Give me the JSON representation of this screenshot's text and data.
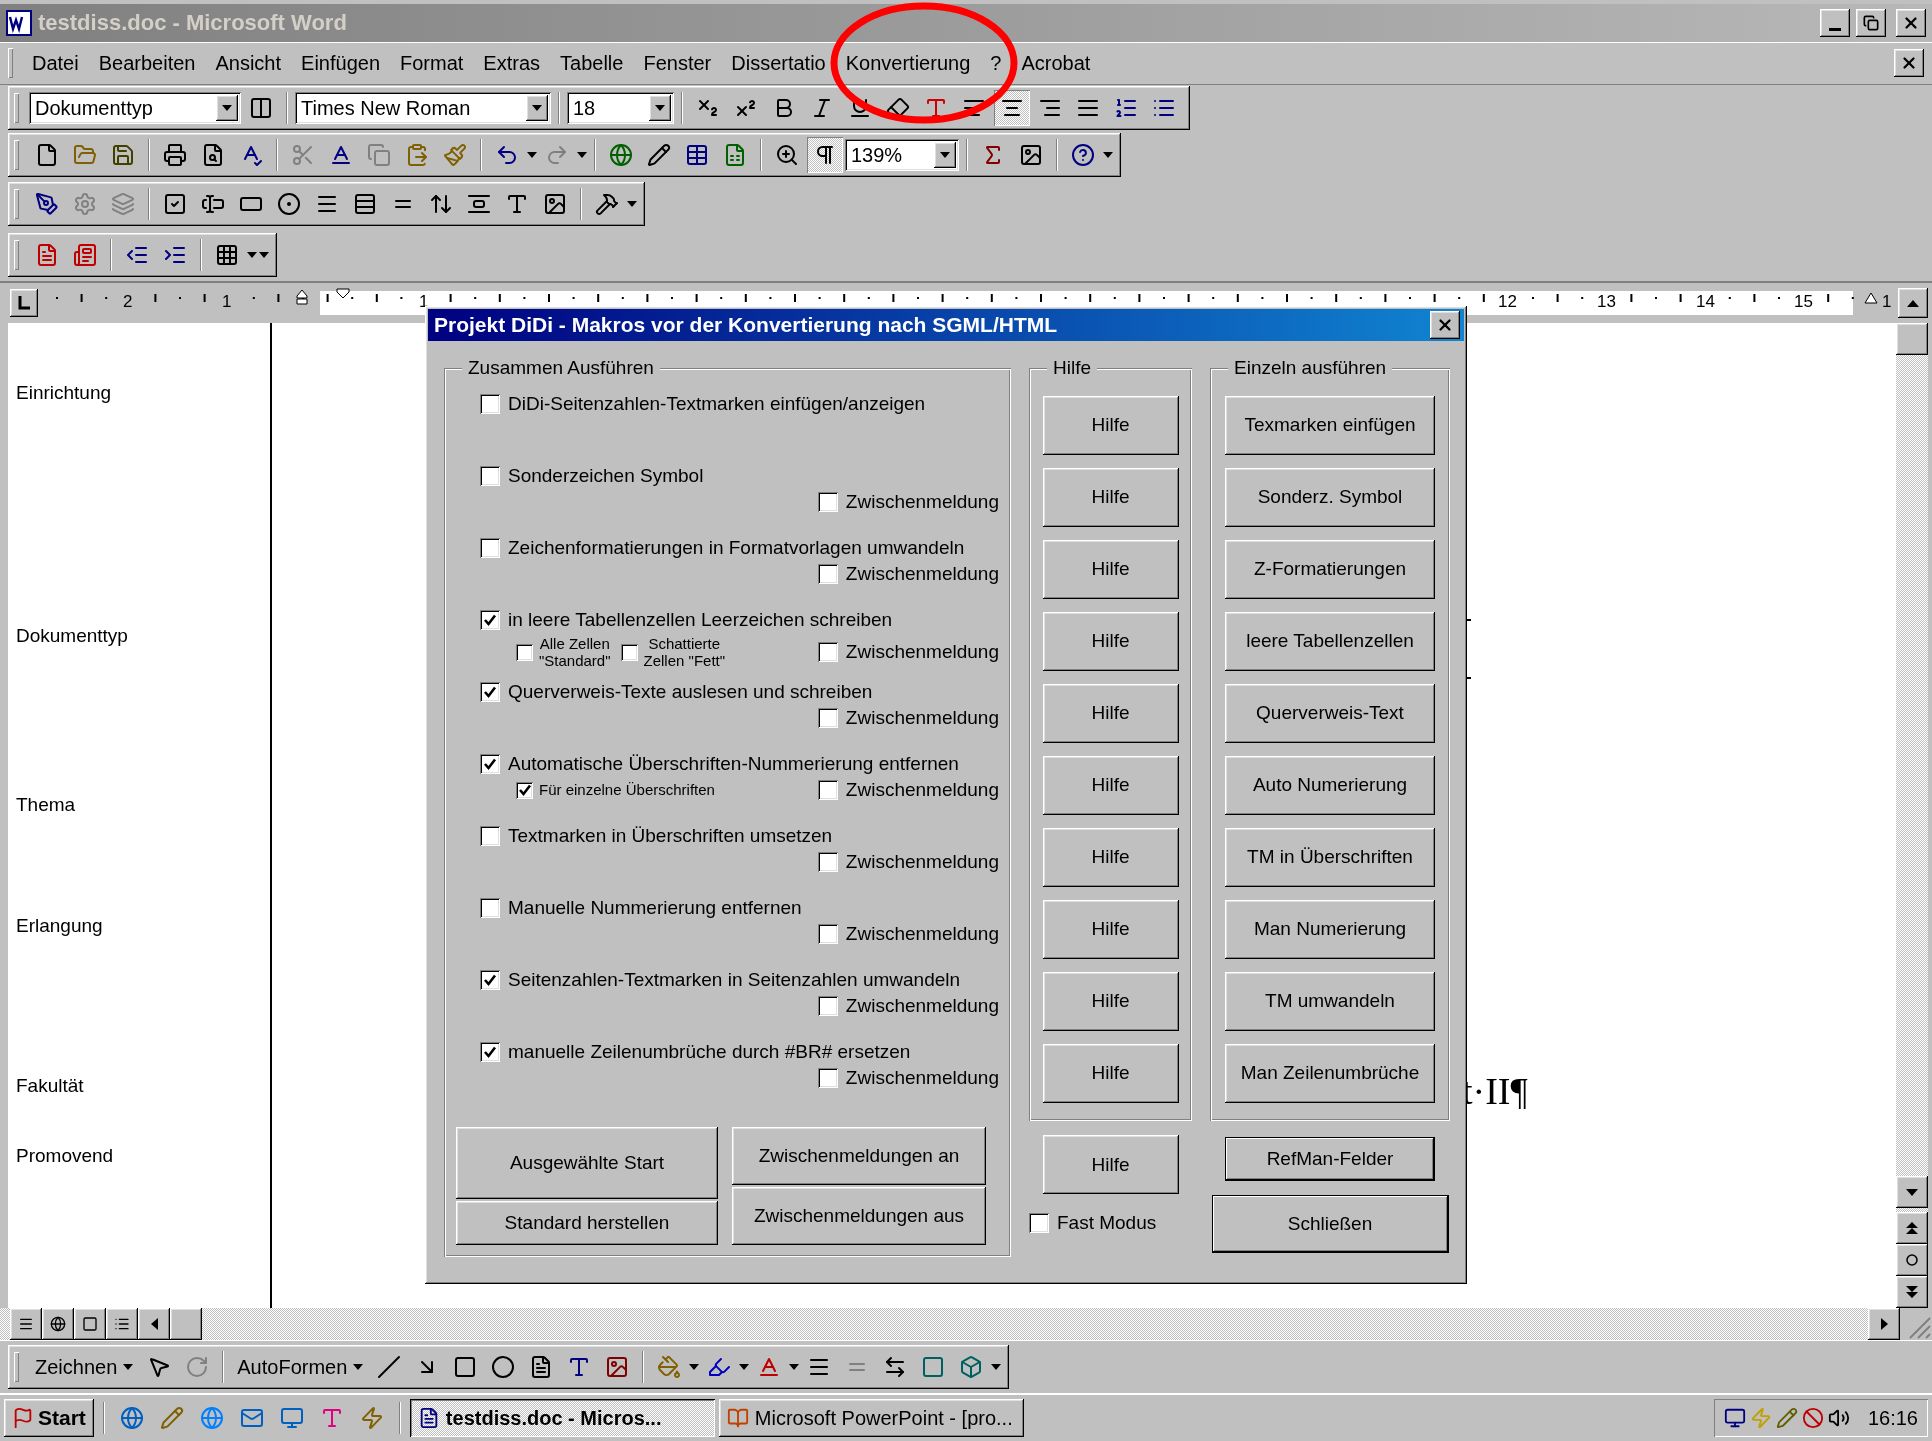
{
  "window": {
    "title": "testdiss.doc - Microsoft Word"
  },
  "menu": [
    "Datei",
    "Bearbeiten",
    "Ansicht",
    "Einfügen",
    "Format",
    "Extras",
    "Tabelle",
    "Fenster",
    "Dissertatio",
    "Konvertierung",
    "?",
    "Acrobat"
  ],
  "formatting_toolbar": {
    "style": "Dokumenttyp",
    "font": "Times New Roman",
    "size": "18",
    "align_center_on": true
  },
  "standard_toolbar": {
    "zoom": "139%",
    "formatting_marks_on": true
  },
  "ruler": {
    "numbers": [
      "2",
      "1",
      "1",
      "12",
      "13",
      "14",
      "15",
      "1"
    ]
  },
  "style_area": [
    "Einrichtung",
    "Dokumenttyp",
    "Thema",
    "Erlangung",
    "Fakultät",
    "Promovend"
  ],
  "document": {
    "fragment": "t·II¶"
  },
  "dialog": {
    "title": "Projekt DiDi - Makros vor der Konvertierung nach SGML/HTML",
    "run_group": {
      "legend": "Zusammen Ausführen",
      "options": [
        {
          "label": "DiDi-Seitenzahlen-Textmarken einfügen/anzeigen",
          "checked": false
        },
        {
          "label": "Sonderzeichen Symbol",
          "checked": false,
          "interim": {
            "label": "Zwischenmeldung",
            "checked": false
          }
        },
        {
          "label": "Zeichenformatierungen in Formatvorlagen umwandeln",
          "checked": false,
          "interim": {
            "label": "Zwischenmeldung",
            "checked": false
          }
        },
        {
          "label": "in leere Tabellenzellen Leerzeichen schreiben",
          "checked": true,
          "suboptions": [
            {
              "label": "Alle Zellen\n\"Standard\"",
              "checked": false
            },
            {
              "label": "Schattierte\nZellen \"Fett\"",
              "checked": false
            }
          ],
          "interim": {
            "label": "Zwischenmeldung",
            "checked": false
          }
        },
        {
          "label": "Querverweis-Texte auslesen und schreiben",
          "checked": true,
          "interim": {
            "label": "Zwischenmeldung",
            "checked": false
          }
        },
        {
          "label": "Automatische Überschriften-Nummerierung entfernen",
          "checked": true,
          "suboptions": [
            {
              "label": "Für einzelne Überschriften",
              "checked": true
            }
          ],
          "interim": {
            "label": "Zwischenmeldung",
            "checked": false
          }
        },
        {
          "label": "Textmarken in Überschriften umsetzen",
          "checked": false,
          "interim": {
            "label": "Zwischenmeldung",
            "checked": false
          }
        },
        {
          "label": "Manuelle Nummerierung entfernen",
          "checked": false,
          "interim": {
            "label": "Zwischenmeldung",
            "checked": false
          }
        },
        {
          "label": "Seitenzahlen-Textmarken in Seitenzahlen umwandeln",
          "checked": true,
          "interim": {
            "label": "Zwischenmeldung",
            "checked": false
          }
        },
        {
          "label": "manuelle Zeilenumbrüche durch #BR#  ersetzen",
          "checked": true,
          "interim": {
            "label": "Zwischenmeldung",
            "checked": false
          }
        }
      ],
      "buttons": [
        "Ausgewählte Start",
        "Standard herstellen",
        "Zwischenmeldungen an",
        "Zwischenmeldungen aus"
      ]
    },
    "help_group": {
      "legend": "Hilfe",
      "buttons": [
        "Hilfe",
        "Hilfe",
        "Hilfe",
        "Hilfe",
        "Hilfe",
        "Hilfe",
        "Hilfe",
        "Hilfe",
        "Hilfe",
        "Hilfe"
      ]
    },
    "single_group": {
      "legend": "Einzeln ausführen",
      "buttons": [
        "Texmarken einfügen",
        "Sonderz. Symbol",
        "Z-Formatierungen",
        "leere Tabellenzellen",
        "Querverweis-Text",
        "Auto Numerierung",
        "TM in Überschriften",
        "Man Numerierung",
        "TM umwandeln",
        "Man Zeilenumbrüche"
      ]
    },
    "help_button": "Hilfe",
    "fast_mode": {
      "label": "Fast Modus",
      "checked": false
    },
    "refman_button": "RefMan-Felder",
    "close_button": "Schließen"
  },
  "drawing_toolbar": {
    "draw_menu": "Zeichnen",
    "autoshapes_menu": "AutoFormen"
  },
  "taskbar": {
    "start": "Start",
    "tasks": [
      {
        "label": "testdiss.doc - Micros...",
        "selected": true
      },
      {
        "label": "Microsoft PowerPoint - [pro...",
        "selected": false
      }
    ],
    "clock": "16:16"
  }
}
